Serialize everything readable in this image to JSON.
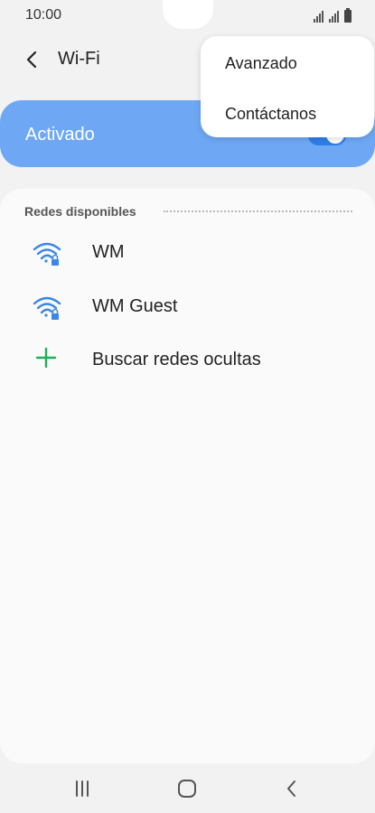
{
  "status_bar": {
    "time": "10:00"
  },
  "header": {
    "title": "Wi-Fi"
  },
  "wifi_toggle": {
    "label": "Activado",
    "on": true,
    "accent": "#2f7fea",
    "card_color": "#6ea8f5"
  },
  "networks_section": {
    "title": "Redes disponibles",
    "items": [
      {
        "label": "WM",
        "icon": "wifi-lock-icon"
      },
      {
        "label": "WM Guest",
        "icon": "wifi-lock-icon"
      }
    ],
    "add_hidden": {
      "label": "Buscar redes ocultas",
      "icon": "plus-icon",
      "color": "#1fae5a"
    }
  },
  "overflow_menu": {
    "items": [
      {
        "label": "Avanzado"
      },
      {
        "label": "Contáctanos"
      }
    ]
  },
  "nav_bar": {
    "buttons": [
      {
        "icon": "recent-apps-icon"
      },
      {
        "icon": "home-icon"
      },
      {
        "icon": "back-nav-icon"
      }
    ]
  }
}
